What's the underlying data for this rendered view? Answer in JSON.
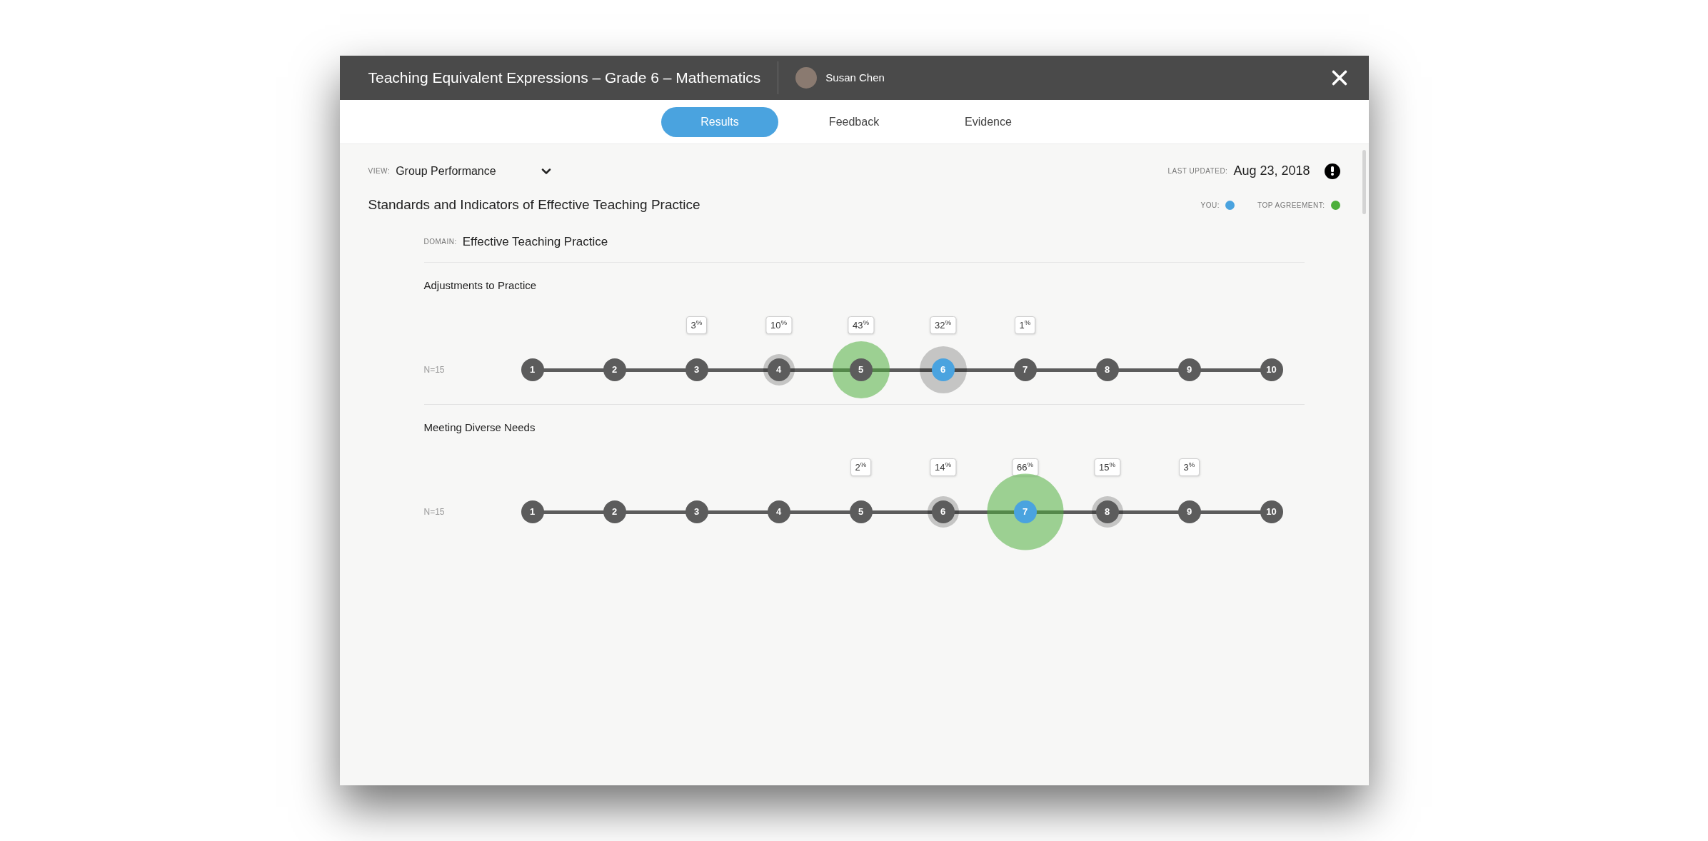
{
  "header": {
    "title": "Teaching Equivalent Expressions – Grade 6 – Mathematics",
    "user": "Susan Chen"
  },
  "tabs": [
    {
      "label": "Results",
      "selected": true
    },
    {
      "label": "Feedback",
      "selected": false
    },
    {
      "label": "Evidence",
      "selected": false
    }
  ],
  "view": {
    "label": "VIEW:",
    "value": "Group Performance"
  },
  "last_updated": {
    "label": "LAST UPDATED:",
    "value": "Aug 23, 2018"
  },
  "heading": "Standards and Indicators of Effective Teaching Practice",
  "legend": [
    {
      "label": "YOU:",
      "color": "#4aa3df"
    },
    {
      "label": "TOP AGREEMENT:",
      "color": "#4caf3a"
    }
  ],
  "domain": {
    "label": "DOMAIN:",
    "value": "Effective Teaching Practice"
  },
  "indicators": [
    {
      "name": "Adjustments to Practice",
      "count": "N=15",
      "points": [
        {
          "label": "1",
          "selected": false
        },
        {
          "label": "2",
          "selected": false
        },
        {
          "label": "3",
          "share": "3$^{%}$",
          "selected": false
        },
        {
          "label": "4",
          "share": "10$^{%}$",
          "halo": {
            "kind": "small",
            "top": false
          },
          "selected": false
        },
        {
          "label": "5",
          "share": "43$^{%}$",
          "halo": {
            "kind": "large",
            "top": true
          },
          "selected": false
        },
        {
          "label": "6",
          "share": "32$^{%}$",
          "halo": {
            "kind": "medium",
            "top": false
          },
          "selected": true
        },
        {
          "label": "7",
          "share": "1$^{%}$",
          "selected": false
        },
        {
          "label": "8",
          "selected": false
        },
        {
          "label": "9",
          "selected": false
        },
        {
          "label": "10",
          "selected": false
        }
      ]
    },
    {
      "name": "Meeting Diverse Needs",
      "count": "N=15",
      "points": [
        {
          "label": "1",
          "selected": false
        },
        {
          "label": "2",
          "selected": false
        },
        {
          "label": "3",
          "selected": false
        },
        {
          "label": "4",
          "selected": false
        },
        {
          "label": "5",
          "share": "2$^{%}$",
          "selected": false
        },
        {
          "label": "6",
          "share": "14$^{%}$",
          "halo": {
            "kind": "small",
            "top": false
          },
          "selected": false
        },
        {
          "label": "7",
          "share": "66$^{%}$",
          "halo": {
            "kind": "xlarge",
            "top": true
          },
          "selected": true
        },
        {
          "label": "8",
          "share": "15$^{%}$",
          "halo": {
            "kind": "small",
            "top": false
          },
          "selected": false
        },
        {
          "label": "9",
          "share": "3$^{%}$",
          "selected": false
        },
        {
          "label": "10",
          "selected": false
        }
      ]
    }
  ]
}
